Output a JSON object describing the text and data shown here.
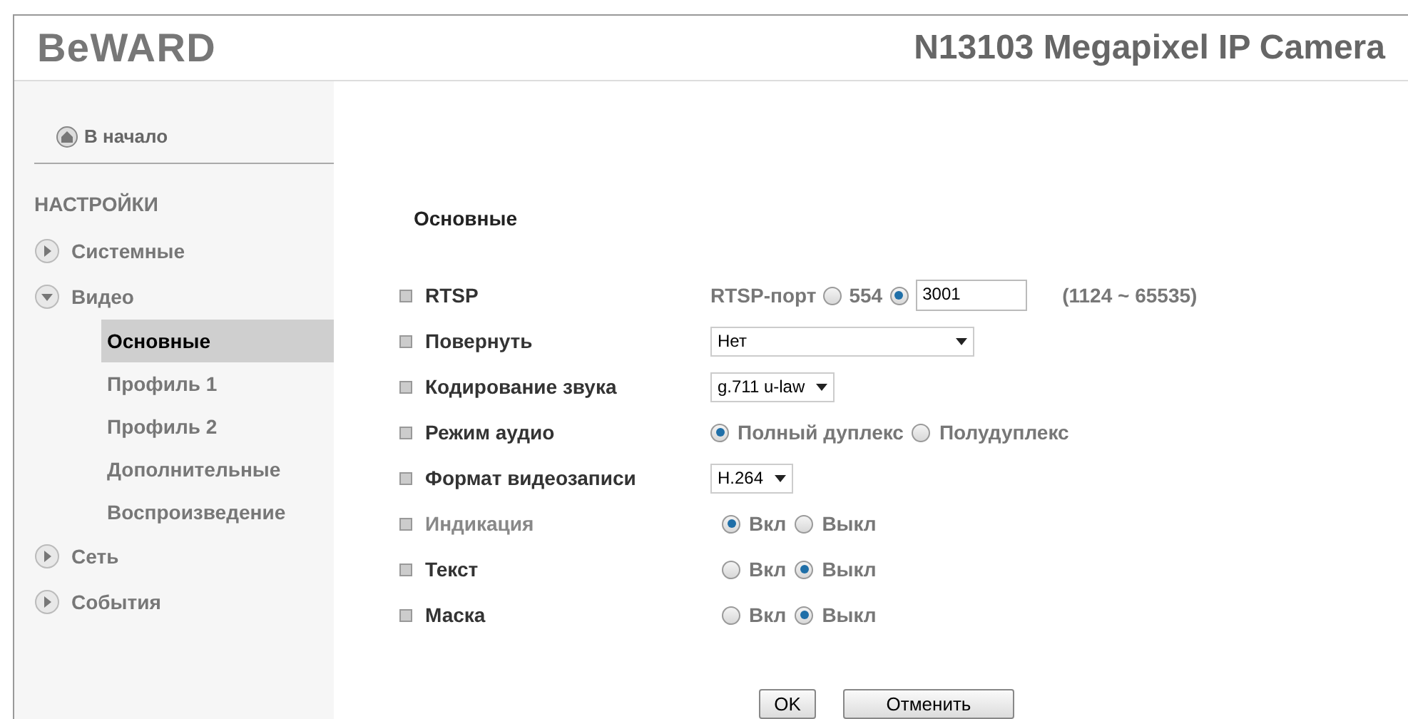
{
  "header": {
    "logo": "BeWARD",
    "title": "N13103 Megapixel IP Camera"
  },
  "sidebar": {
    "home": "В начало",
    "section": "НАСТРОЙКИ",
    "items": [
      {
        "label": "Системные",
        "expanded": false
      },
      {
        "label": "Видео",
        "expanded": true,
        "children": [
          {
            "label": "Основные",
            "selected": true
          },
          {
            "label": "Профиль 1",
            "selected": false
          },
          {
            "label": "Профиль 2",
            "selected": false
          },
          {
            "label": "Дополнительные",
            "selected": false
          },
          {
            "label": "Воспроизведение",
            "selected": false
          }
        ]
      },
      {
        "label": "Сеть",
        "expanded": false
      },
      {
        "label": "События",
        "expanded": false
      }
    ]
  },
  "form": {
    "title": "Основные",
    "rows": [
      {
        "kind": "port",
        "label": "RTSP",
        "disabled": false,
        "prefix": "RTSP-порт",
        "options": [
          {
            "label": "554",
            "selected": false
          },
          {
            "selected": true
          }
        ],
        "value": "3001",
        "range": "(1124 ~ 65535)"
      },
      {
        "kind": "select",
        "label": "Повернуть",
        "disabled": false,
        "value": "Нет",
        "wide": true
      },
      {
        "kind": "select",
        "label": "Кодирование звука",
        "disabled": false,
        "value": "g.711 u-law",
        "wide": false
      },
      {
        "kind": "radio",
        "label": "Режим аудио",
        "disabled": false,
        "options": [
          {
            "label": "Полный дуплекс",
            "selected": true
          },
          {
            "label": "Полудуплекс",
            "selected": false
          }
        ]
      },
      {
        "kind": "select",
        "label": "Формат видеозаписи",
        "disabled": false,
        "value": "H.264",
        "wide": false
      },
      {
        "kind": "radio",
        "label": "Индикация",
        "disabled": true,
        "options": [
          {
            "label": "Вкл",
            "selected": true
          },
          {
            "label": "Выкл",
            "selected": false
          }
        ]
      },
      {
        "kind": "radio",
        "label": "Текст",
        "disabled": false,
        "options": [
          {
            "label": "Вкл",
            "selected": false
          },
          {
            "label": "Выкл",
            "selected": true
          }
        ]
      },
      {
        "kind": "radio",
        "label": "Маска",
        "disabled": false,
        "options": [
          {
            "label": "Вкл",
            "selected": false
          },
          {
            "label": "Выкл",
            "selected": true
          }
        ]
      }
    ],
    "buttons": [
      "OK",
      "Отменить"
    ]
  }
}
